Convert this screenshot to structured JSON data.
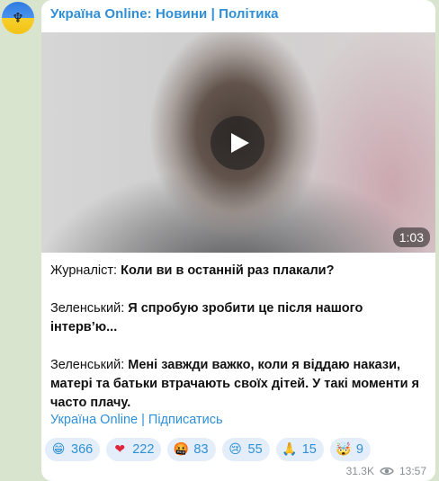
{
  "channel": {
    "name": "Україна Online: Новини | Політика",
    "avatar_icon": "ukraine-trident-icon"
  },
  "video": {
    "duration": "1:03",
    "play_icon": "play-icon"
  },
  "message": {
    "lines": [
      {
        "speaker": "Журналіст:",
        "text": "Коли ви в останній раз плакали?"
      },
      {
        "speaker": "Зеленський:",
        "text": "Я спробую зробити це після нашого інтерв’ю..."
      },
      {
        "speaker": "Зеленський:",
        "text": "Мені завжди важко, коли я віддаю накази, матері та батьки втрачають своїх дітей. У такі моменти я часто плачу."
      }
    ],
    "footer_link": "Україна Online | Підписатись"
  },
  "reactions": [
    {
      "icon": "grinning-face-icon",
      "glyph": "😁",
      "count": "366"
    },
    {
      "icon": "red-heart-icon",
      "glyph": "❤",
      "count": "222"
    },
    {
      "icon": "angry-face-icon",
      "glyph": "🤬",
      "count": "83"
    },
    {
      "icon": "crying-face-icon",
      "glyph": "😢",
      "count": "55"
    },
    {
      "icon": "folded-hands-icon",
      "glyph": "🙏",
      "count": "15"
    },
    {
      "icon": "exploding-head-icon",
      "glyph": "🤯",
      "count": "9"
    }
  ],
  "meta": {
    "views": "31.3K",
    "time": "13:57"
  },
  "colors": {
    "accent": "#2f8fd6",
    "reaction_bg": "#e3eefa",
    "chat_bg": "#d9e4cf"
  }
}
